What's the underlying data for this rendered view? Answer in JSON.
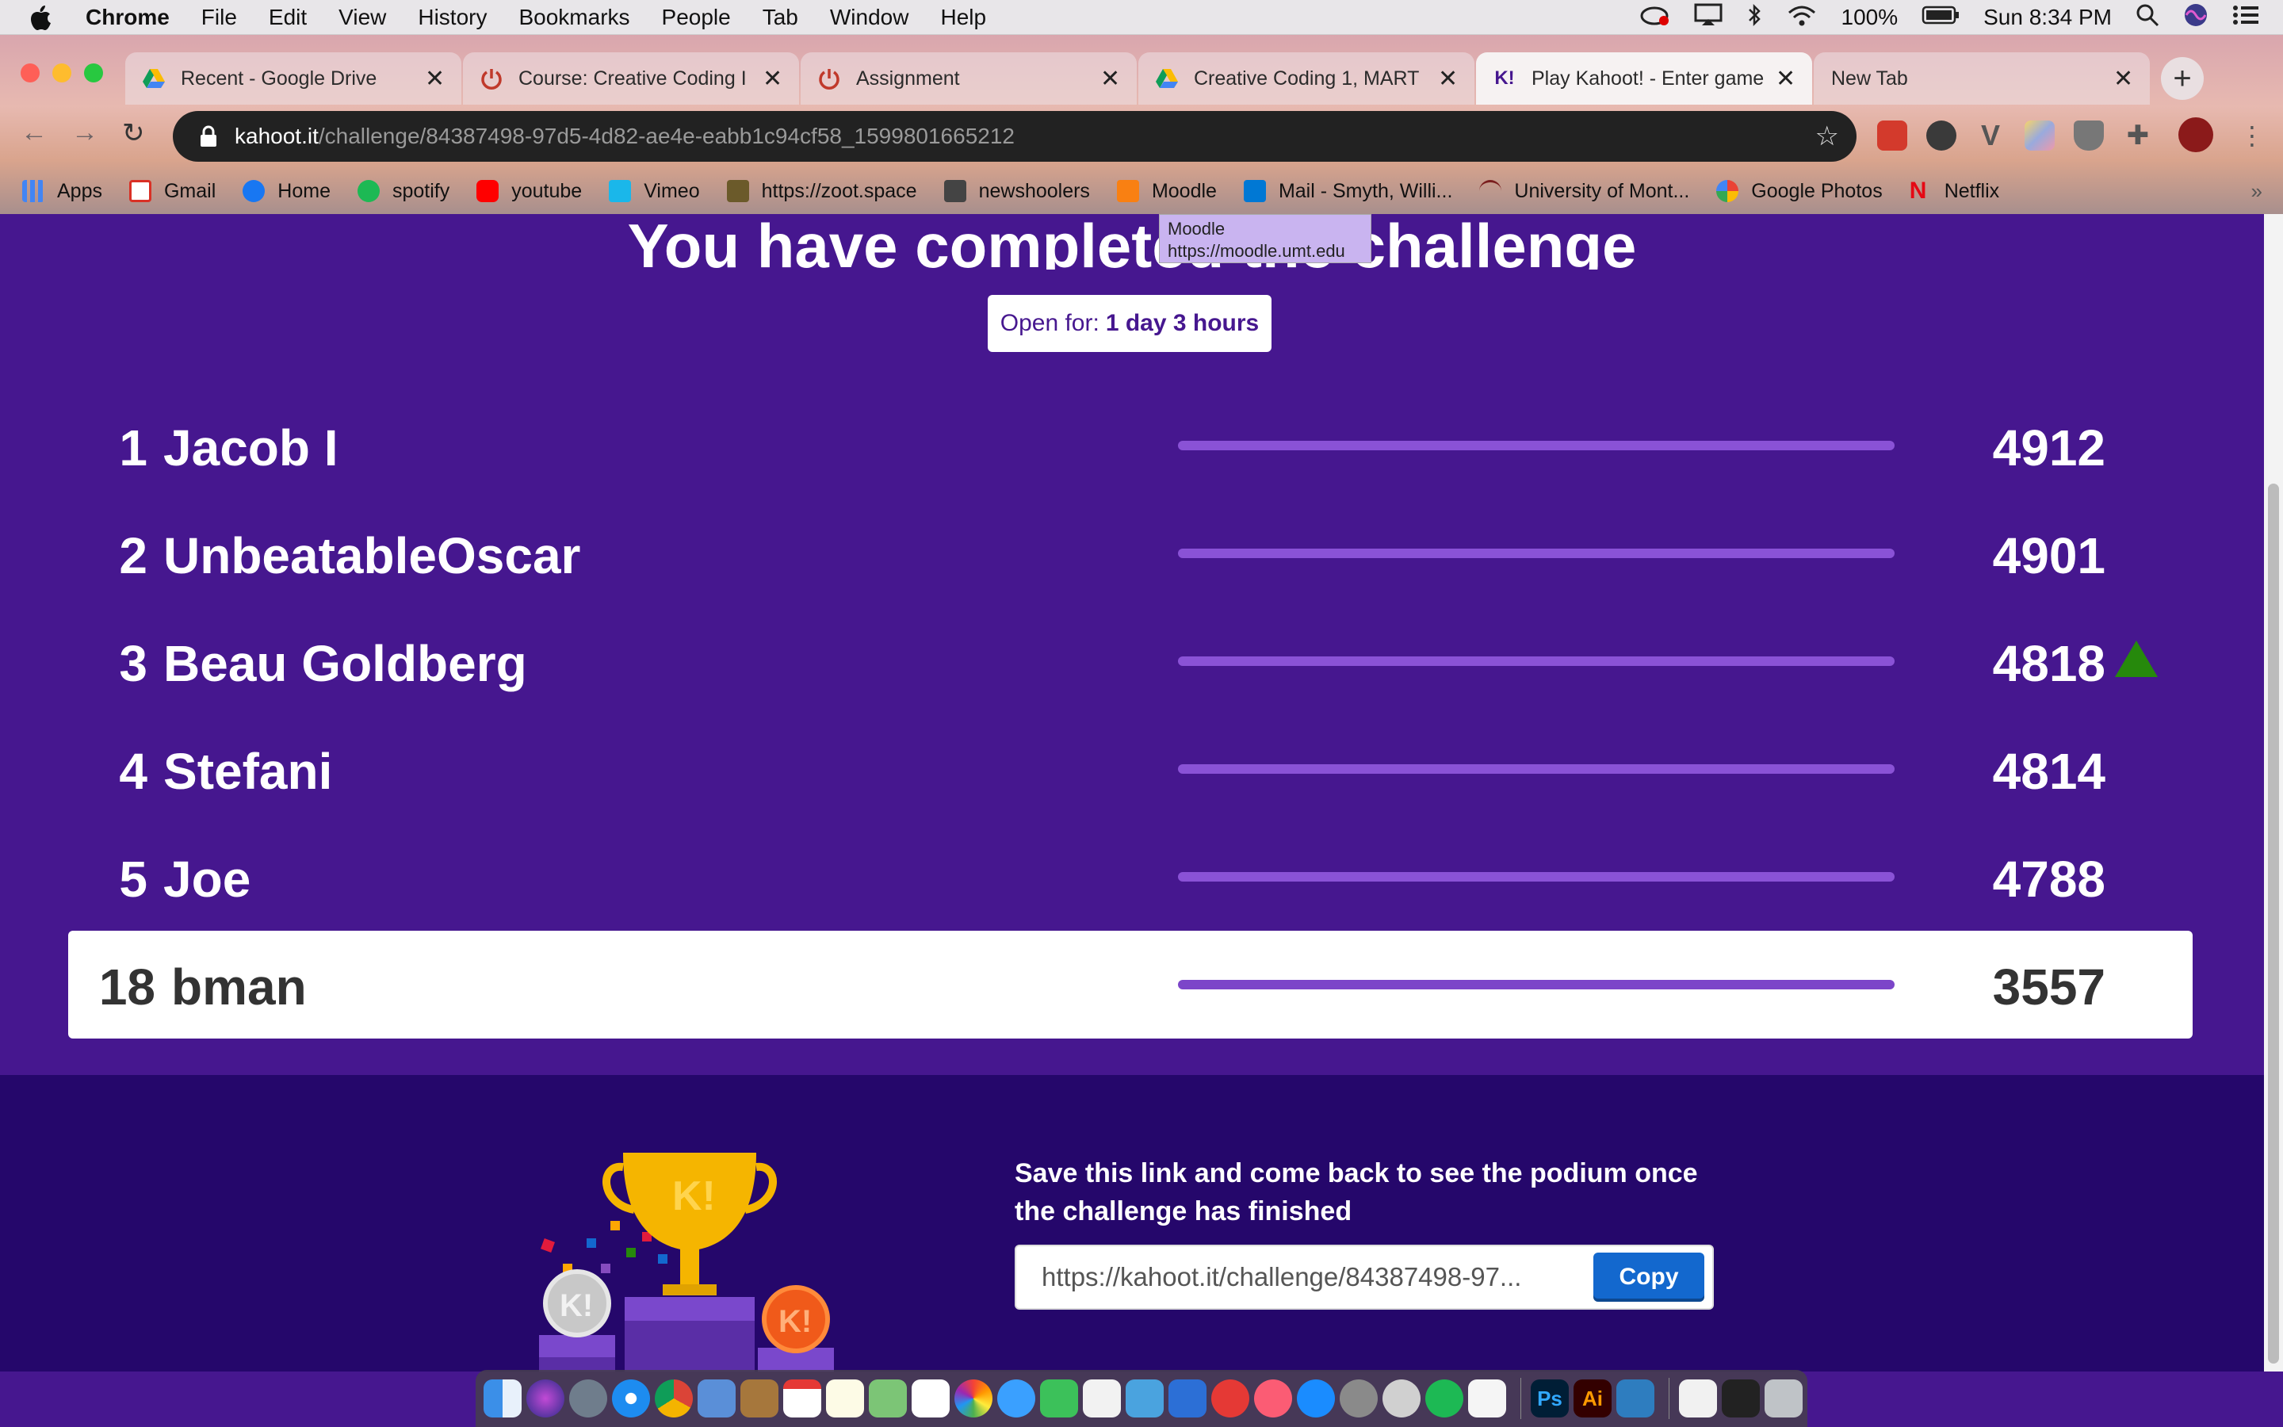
{
  "menubar": {
    "app_name": "Chrome",
    "menus": [
      "File",
      "Edit",
      "View",
      "History",
      "Bookmarks",
      "People",
      "Tab",
      "Window",
      "Help"
    ],
    "battery": "100%",
    "clock": "Sun 8:34 PM"
  },
  "tabs": [
    {
      "title": "Recent - Google Drive",
      "icon": "google-drive-icon"
    },
    {
      "title": "Course: Creative Coding I",
      "icon": "moodle-power-icon"
    },
    {
      "title": "Assignment",
      "icon": "moodle-power-icon"
    },
    {
      "title": "Creative Coding 1, MART",
      "icon": "google-drive-icon"
    },
    {
      "title": "Play Kahoot! - Enter game",
      "icon": "kahoot-icon"
    },
    {
      "title": "New Tab",
      "icon": ""
    }
  ],
  "address": {
    "host": "kahoot.it",
    "path": "/challenge/84387498-97d5-4d82-ae4e-eabb1c94cf58_1599801665212"
  },
  "bookmarks": [
    {
      "label": "Apps",
      "color": "#4285f4"
    },
    {
      "label": "Gmail",
      "color": "#d93025"
    },
    {
      "label": "Home",
      "color": "#1877f2"
    },
    {
      "label": "spotify",
      "color": "#1db954"
    },
    {
      "label": "youtube",
      "color": "#ff0000"
    },
    {
      "label": "Vimeo",
      "color": "#1ab7ea"
    },
    {
      "label": "https://zoot.space",
      "color": "#6b5a2a"
    },
    {
      "label": "newshoolers",
      "color": "#333333"
    },
    {
      "label": "Moodle",
      "color": "#f98012"
    },
    {
      "label": "Mail - Smyth, Willi...",
      "color": "#0078d4"
    },
    {
      "label": "University of Mont...",
      "color": "#7a1e1e"
    },
    {
      "label": "Google Photos",
      "color": "#fbbc04"
    },
    {
      "label": "Netflix",
      "color": "#e50914"
    }
  ],
  "tooltip": {
    "title": "Moodle",
    "url": "https://moodle.umt.edu"
  },
  "page": {
    "headline": "You have completed the challenge",
    "open_for_label": "Open for:",
    "open_for_value": "1 day 3 hours"
  },
  "leaderboard": [
    {
      "rank": "1",
      "name": "Jacob I",
      "score": "4912",
      "progress": 1.0
    },
    {
      "rank": "2",
      "name": "UnbeatableOscar",
      "score": "4901",
      "progress": 1.0
    },
    {
      "rank": "3",
      "name": "Beau Goldberg",
      "score": "4818",
      "progress": 1.0,
      "trend": "up"
    },
    {
      "rank": "4",
      "name": "Stefani",
      "score": "4814",
      "progress": 1.0
    },
    {
      "rank": "5",
      "name": "Joe",
      "score": "4788",
      "progress": 1.0
    }
  ],
  "current_player": {
    "rank": "18",
    "name": "bman",
    "score": "3557",
    "progress": 1.0
  },
  "footer": {
    "message": "Save this link and come back to see the podium once the challenge has finished",
    "link": "https://kahoot.it/challenge/84387498-97...",
    "copy_label": "Copy"
  },
  "colors": {
    "kahoot_purple": "#46178f",
    "footer_purple": "#25076b",
    "copy_blue": "#1368ce",
    "trend_green": "#26890c"
  }
}
